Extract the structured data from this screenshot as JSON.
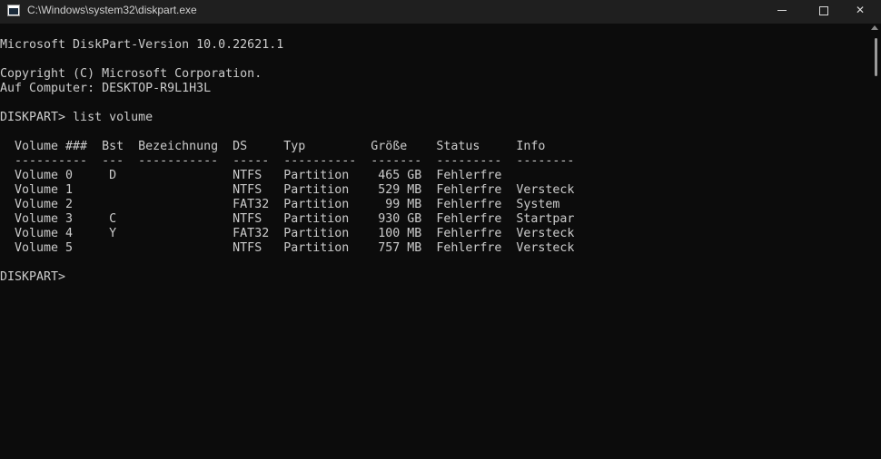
{
  "window": {
    "title": "C:\\Windows\\system32\\diskpart.exe",
    "controls": {
      "close": "✕"
    }
  },
  "console": {
    "lines": [
      "Microsoft DiskPart-Version 10.0.22621.1",
      "",
      "Copyright (C) Microsoft Corporation.",
      "Auf Computer: DESKTOP-R9L1H3L",
      "",
      "DISKPART> list volume",
      "",
      "  Volume ###  Bst  Bezeichnung  DS     Typ         Größe    Status     Info",
      "  ----------  ---  -----------  -----  ----------  -------  ---------  --------",
      "  Volume 0     D                NTFS   Partition    465 GB  Fehlerfre",
      "  Volume 1                      NTFS   Partition    529 MB  Fehlerfre  Versteck",
      "  Volume 2                      FAT32  Partition     99 MB  Fehlerfre  System",
      "  Volume 3     C                NTFS   Partition    930 GB  Fehlerfre  Startpar",
      "  Volume 4     Y                FAT32  Partition    100 MB  Fehlerfre  Versteck",
      "  Volume 5                      NTFS   Partition    757 MB  Fehlerfre  Versteck",
      "",
      "DISKPART>"
    ]
  }
}
